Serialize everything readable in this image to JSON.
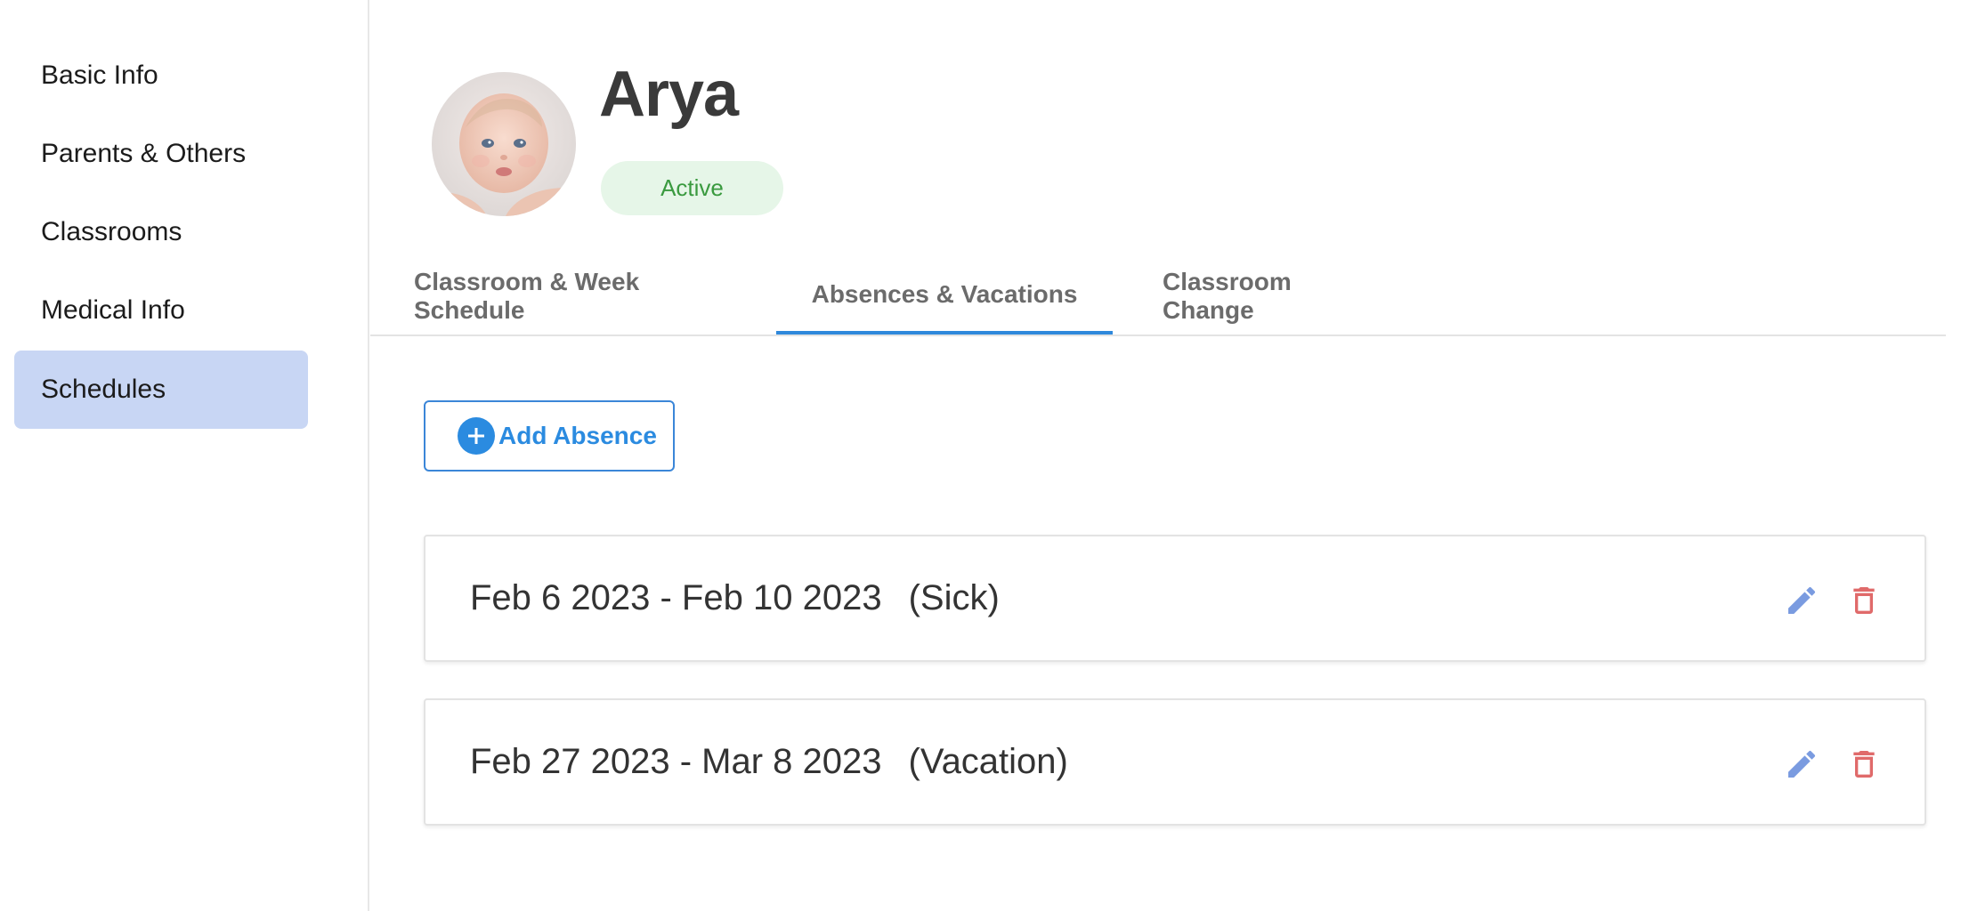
{
  "sidebar": {
    "items": [
      {
        "label": "Basic Info"
      },
      {
        "label": "Parents & Others"
      },
      {
        "label": "Classrooms"
      },
      {
        "label": "Medical Info"
      },
      {
        "label": "Schedules"
      }
    ],
    "active_index": 4
  },
  "profile": {
    "name": "Arya",
    "status": "Active"
  },
  "tabs": [
    {
      "label": "Classroom & Week Schedule"
    },
    {
      "label": "Absences & Vacations"
    },
    {
      "label": "Classroom Change"
    }
  ],
  "actions": {
    "add_label": "Add Absence"
  },
  "absences": [
    {
      "dates": "Feb 6 2023 - Feb 10 2023",
      "reason": "(Sick)"
    },
    {
      "dates": "Feb 27 2023 - Mar 8 2023",
      "reason": "(Vacation)"
    }
  ],
  "icons": {
    "edit": "pencil-icon",
    "delete": "trash-icon",
    "add": "plus-circle-icon"
  },
  "colors": {
    "accent": "#2b8be0",
    "sidebar_active": "#c8d6f4",
    "status_bg": "#e6f6e8",
    "status_text": "#3a9a3f",
    "edit_icon": "#7a9be0",
    "delete_icon": "#e06a6a"
  }
}
